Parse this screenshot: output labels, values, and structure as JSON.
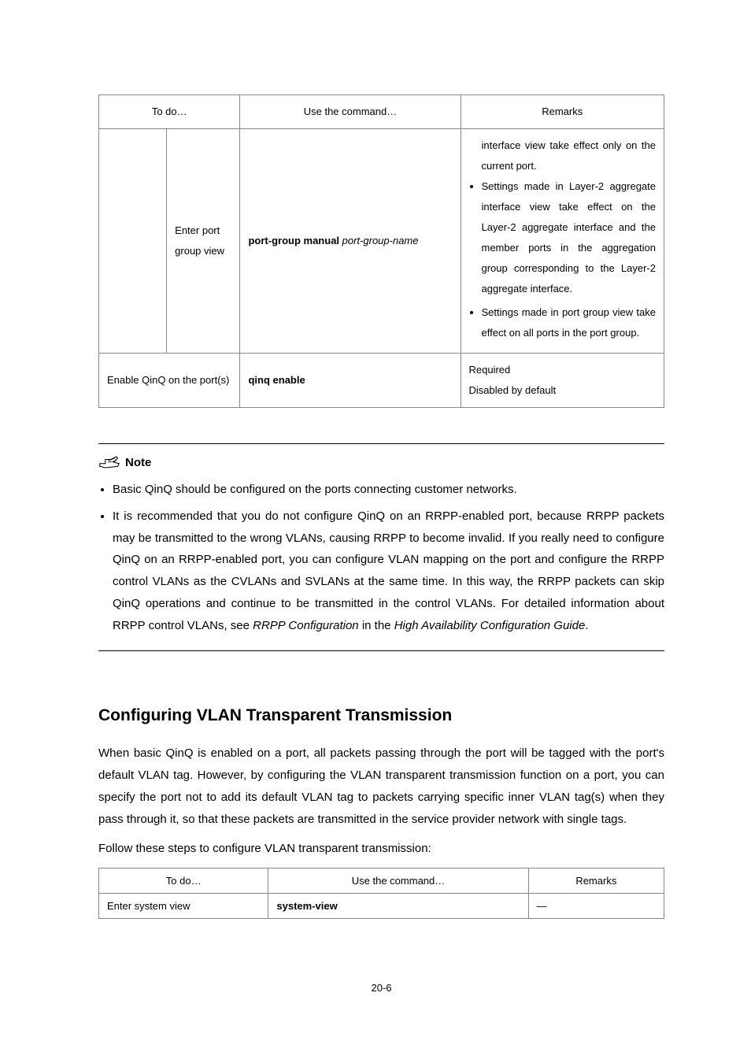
{
  "table_top": {
    "headers": [
      "To do…",
      "Use the command…",
      "Remarks"
    ],
    "row1": {
      "col1": "Enter port group view",
      "col2_cmd": "port-group manual",
      "col2_arg": "port-group-name",
      "col3_line1": "interface view take effect only on the current port.",
      "col3_bullets": [
        "Settings made in Layer-2 aggregate interface view take effect on the Layer-2 aggregate interface and the member ports in the aggregation group corresponding to the Layer-2 aggregate interface.",
        "Settings made in port group view take effect on all ports in the port group."
      ]
    },
    "row2": {
      "col1": "Enable QinQ on the port(s)",
      "col2": "qinq enable",
      "col3_line1": "Required",
      "col3_line2": "Disabled by default"
    }
  },
  "note": {
    "title": "Note",
    "items": [
      "Basic QinQ should be configured on the ports connecting customer networks.",
      "It is recommended that you do not configure QinQ on an RRPP-enabled port, because RRPP packets may be transmitted to the wrong VLANs, causing RRPP to become invalid. If you really need to configure QinQ on an RRPP-enabled port, you can configure VLAN mapping on the port and configure the RRPP control VLANs as the CVLANs and SVLANs at the same time. In this way, the RRPP packets can skip QinQ operations and continue to be transmitted in the control VLANs. For detailed information about RRPP control VLANs, see "
    ],
    "ital1": "RRPP Configuration",
    "mid": " in the ",
    "ital2": "High Availability Configuration Guide",
    "period": "."
  },
  "section_heading": "Configuring VLAN Transparent Transmission",
  "body_para1": "When basic QinQ is enabled on a port, all packets passing through the port will be tagged with the port's default VLAN tag. However, by configuring the VLAN transparent transmission function on a port, you can specify the port not to add its default VLAN tag to packets carrying specific inner VLAN tag(s) when they pass through it, so that these packets are transmitted in the service provider network with single tags.",
  "body_para2": "Follow these steps to configure VLAN transparent transmission:",
  "table_bottom": {
    "headers": [
      "To do…",
      "Use the command…",
      "Remarks"
    ],
    "row1": {
      "col1": "Enter system view",
      "col2": "system-view",
      "col3": "—"
    }
  },
  "page_number": "20-6"
}
